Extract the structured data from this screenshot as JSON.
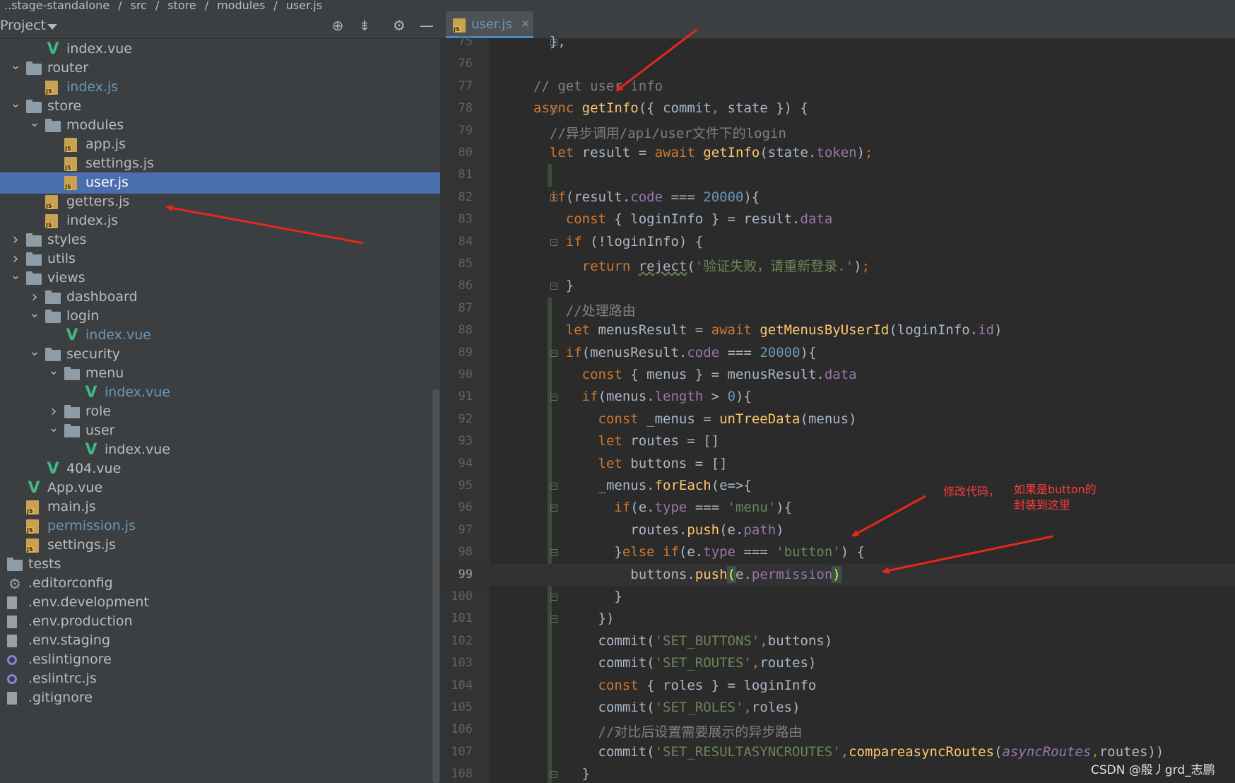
{
  "breadcrumb": {
    "items": [
      "..stage-standalone",
      "src",
      "store",
      "modules",
      "user.js"
    ]
  },
  "project_panel": {
    "title": "Project",
    "header_icons": [
      "locate-icon",
      "collapse-icon",
      "gear-icon",
      "minimize-icon"
    ]
  },
  "tree": [
    {
      "label": "index.vue",
      "type": "vue",
      "depth": 2,
      "arrow": ""
    },
    {
      "label": "router",
      "type": "folder",
      "depth": 1,
      "arrow": "open"
    },
    {
      "label": "index.js",
      "type": "js",
      "depth": 2,
      "arrow": "",
      "color": "blue"
    },
    {
      "label": "store",
      "type": "folder",
      "depth": 1,
      "arrow": "open"
    },
    {
      "label": "modules",
      "type": "folder",
      "depth": 2,
      "arrow": "open"
    },
    {
      "label": "app.js",
      "type": "js",
      "depth": 3,
      "arrow": ""
    },
    {
      "label": "settings.js",
      "type": "js",
      "depth": 3,
      "arrow": ""
    },
    {
      "label": "user.js",
      "type": "js",
      "depth": 3,
      "arrow": "",
      "selected": true
    },
    {
      "label": "getters.js",
      "type": "js",
      "depth": 2,
      "arrow": ""
    },
    {
      "label": "index.js",
      "type": "js",
      "depth": 2,
      "arrow": ""
    },
    {
      "label": "styles",
      "type": "folder",
      "depth": 1,
      "arrow": "closed"
    },
    {
      "label": "utils",
      "type": "folder",
      "depth": 1,
      "arrow": "closed"
    },
    {
      "label": "views",
      "type": "folder",
      "depth": 1,
      "arrow": "open"
    },
    {
      "label": "dashboard",
      "type": "folder",
      "depth": 2,
      "arrow": "closed"
    },
    {
      "label": "login",
      "type": "folder",
      "depth": 2,
      "arrow": "open"
    },
    {
      "label": "index.vue",
      "type": "vue",
      "depth": 3,
      "arrow": "",
      "color": "blue"
    },
    {
      "label": "security",
      "type": "folder",
      "depth": 2,
      "arrow": "open"
    },
    {
      "label": "menu",
      "type": "folder",
      "depth": 3,
      "arrow": "open"
    },
    {
      "label": "index.vue",
      "type": "vue",
      "depth": 4,
      "arrow": "",
      "color": "blue"
    },
    {
      "label": "role",
      "type": "folder",
      "depth": 3,
      "arrow": "closed"
    },
    {
      "label": "user",
      "type": "folder",
      "depth": 3,
      "arrow": "open"
    },
    {
      "label": "index.vue",
      "type": "vue",
      "depth": 4,
      "arrow": ""
    },
    {
      "label": "404.vue",
      "type": "vue",
      "depth": 2,
      "arrow": ""
    },
    {
      "label": "App.vue",
      "type": "vue",
      "depth": 1,
      "arrow": ""
    },
    {
      "label": "main.js",
      "type": "js",
      "depth": 1,
      "arrow": ""
    },
    {
      "label": "permission.js",
      "type": "js",
      "depth": 1,
      "arrow": "",
      "color": "blue"
    },
    {
      "label": "settings.js",
      "type": "js",
      "depth": 1,
      "arrow": ""
    },
    {
      "label": "tests",
      "type": "folder",
      "depth": 0,
      "arrow": ""
    },
    {
      "label": ".editorconfig",
      "type": "gear",
      "depth": 0,
      "arrow": ""
    },
    {
      "label": ".env.development",
      "type": "file",
      "depth": 0,
      "arrow": ""
    },
    {
      "label": ".env.production",
      "type": "file",
      "depth": 0,
      "arrow": ""
    },
    {
      "label": ".env.staging",
      "type": "file",
      "depth": 0,
      "arrow": ""
    },
    {
      "label": ".eslintignore",
      "type": "ring",
      "depth": 0,
      "arrow": ""
    },
    {
      "label": ".eslintrc.js",
      "type": "ring",
      "depth": 0,
      "arrow": ""
    },
    {
      "label": ".gitignore",
      "type": "file",
      "depth": 0,
      "arrow": ""
    }
  ],
  "editor": {
    "tab_label": "user.js",
    "current_line": "99",
    "lines": [
      {
        "n": "75",
        "t": [
          [
            "",
            "  },"
          ]
        ]
      },
      {
        "n": "76",
        "t": []
      },
      {
        "n": "77",
        "t": [
          [
            "cm",
            "// get user info"
          ]
        ]
      },
      {
        "n": "78",
        "t": [
          [
            "kw",
            "async "
          ],
          [
            "fn",
            "getInfo"
          ],
          [
            "",
            "({ commit"
          ],
          [
            "kw",
            ", "
          ],
          [
            "",
            "state }) {"
          ]
        ]
      },
      {
        "n": "79",
        "t": [
          [
            "cm",
            "  //异步调用/api/user文件下的login"
          ]
        ]
      },
      {
        "n": "80",
        "t": [
          [
            "kw",
            "  let "
          ],
          [
            "",
            "result = "
          ],
          [
            "kw",
            "await "
          ],
          [
            "fn",
            "getInfo"
          ],
          [
            "",
            "(state."
          ],
          [
            "prop",
            "token"
          ],
          [
            "",
            ")"
          ],
          [
            "kw",
            ";"
          ]
        ]
      },
      {
        "n": "81",
        "t": []
      },
      {
        "n": "82",
        "t": [
          [
            "kw",
            "  if"
          ],
          [
            "",
            "(result."
          ],
          [
            "prop",
            "code"
          ],
          [
            "",
            " === "
          ],
          [
            "num",
            "20000"
          ],
          [
            "",
            "){"
          ]
        ]
      },
      {
        "n": "83",
        "t": [
          [
            "kw",
            "    const "
          ],
          [
            "",
            "{ loginInfo } = result."
          ],
          [
            "prop",
            "data"
          ]
        ]
      },
      {
        "n": "84",
        "t": [
          [
            "kw",
            "    if "
          ],
          [
            "",
            "(!loginInfo) {"
          ]
        ]
      },
      {
        "n": "85",
        "t": [
          [
            "kw",
            "      return "
          ],
          [
            "und",
            "reject"
          ],
          [
            "",
            "("
          ],
          [
            "str",
            "'验证失败，请重新登录.'"
          ],
          [
            "",
            ")"
          ],
          [
            "kw",
            ";"
          ]
        ]
      },
      {
        "n": "86",
        "t": [
          [
            "",
            "    }"
          ]
        ]
      },
      {
        "n": "87",
        "t": [
          [
            "cm",
            "    //处理路由"
          ]
        ]
      },
      {
        "n": "88",
        "t": [
          [
            "kw",
            "    let "
          ],
          [
            "",
            "menusResult = "
          ],
          [
            "kw",
            "await "
          ],
          [
            "fn",
            "getMenusByUserId"
          ],
          [
            "",
            "(loginInfo."
          ],
          [
            "prop",
            "id"
          ],
          [
            "",
            ")"
          ]
        ]
      },
      {
        "n": "89",
        "t": [
          [
            "kw",
            "    if"
          ],
          [
            "",
            "(menusResult."
          ],
          [
            "prop",
            "code"
          ],
          [
            "",
            " === "
          ],
          [
            "num",
            "20000"
          ],
          [
            "",
            "){"
          ]
        ]
      },
      {
        "n": "90",
        "t": [
          [
            "kw",
            "      const "
          ],
          [
            "",
            "{ menus } = menusResult."
          ],
          [
            "prop",
            "data"
          ]
        ]
      },
      {
        "n": "91",
        "t": [
          [
            "kw",
            "      if"
          ],
          [
            "",
            "(menus."
          ],
          [
            "prop",
            "length"
          ],
          [
            "",
            " > "
          ],
          [
            "num",
            "0"
          ],
          [
            "",
            "){"
          ]
        ]
      },
      {
        "n": "92",
        "t": [
          [
            "kw",
            "        const "
          ],
          [
            "",
            "_menus = "
          ],
          [
            "fn",
            "unTreeData"
          ],
          [
            "",
            "(menus)"
          ]
        ]
      },
      {
        "n": "93",
        "t": [
          [
            "kw",
            "        let "
          ],
          [
            "",
            "routes = []"
          ]
        ]
      },
      {
        "n": "94",
        "t": [
          [
            "kw",
            "        let "
          ],
          [
            "",
            "buttons = []"
          ]
        ]
      },
      {
        "n": "95",
        "t": [
          [
            "",
            "        _menus."
          ],
          [
            "fn",
            "forEach"
          ],
          [
            "",
            "(e=>{"
          ]
        ]
      },
      {
        "n": "96",
        "t": [
          [
            "kw",
            "          if"
          ],
          [
            "",
            "(e."
          ],
          [
            "prop",
            "type"
          ],
          [
            "",
            " === "
          ],
          [
            "str",
            "'menu'"
          ],
          [
            "",
            "){"
          ]
        ]
      },
      {
        "n": "97",
        "t": [
          [
            "",
            "            routes."
          ],
          [
            "fn",
            "push"
          ],
          [
            "",
            "(e."
          ],
          [
            "prop",
            "path"
          ],
          [
            "",
            ")"
          ]
        ]
      },
      {
        "n": "98",
        "t": [
          [
            "",
            "          }"
          ],
          [
            "kw",
            "else if"
          ],
          [
            "",
            "(e."
          ],
          [
            "prop",
            "type"
          ],
          [
            "",
            " === "
          ],
          [
            "str",
            "'button'"
          ],
          [
            "",
            ") {"
          ]
        ]
      },
      {
        "n": "99",
        "t": [
          [
            "",
            "            buttons."
          ],
          [
            "fn",
            "push"
          ],
          [
            "mark",
            "("
          ],
          [
            "",
            "e."
          ],
          [
            "prop",
            "permission"
          ],
          [
            "mark",
            ")"
          ]
        ]
      },
      {
        "n": "100",
        "t": [
          [
            "",
            "          }"
          ]
        ]
      },
      {
        "n": "101",
        "t": [
          [
            "",
            "        })"
          ]
        ]
      },
      {
        "n": "102",
        "t": [
          [
            "",
            "        commit("
          ],
          [
            "str",
            "'SET_BUTTONS'"
          ],
          [
            "kw",
            ","
          ],
          [
            "",
            "buttons)"
          ]
        ]
      },
      {
        "n": "103",
        "t": [
          [
            "",
            "        commit("
          ],
          [
            "str",
            "'SET_ROUTES'"
          ],
          [
            "kw",
            ","
          ],
          [
            "",
            "routes)"
          ]
        ]
      },
      {
        "n": "104",
        "t": [
          [
            "kw",
            "        const "
          ],
          [
            "",
            "{ roles } = loginInfo"
          ]
        ]
      },
      {
        "n": "105",
        "t": [
          [
            "",
            "        commit("
          ],
          [
            "str",
            "'SET_ROLES'"
          ],
          [
            "kw",
            ","
          ],
          [
            "",
            "roles)"
          ]
        ]
      },
      {
        "n": "106",
        "t": [
          [
            "cm",
            "        //对比后设置需要展示的异步路由"
          ]
        ]
      },
      {
        "n": "107",
        "t": [
          [
            "",
            "        commit("
          ],
          [
            "str",
            "'SET_RESULTASYNCROUTES'"
          ],
          [
            "kw",
            ","
          ],
          [
            "fn",
            "compareasyncRoutes"
          ],
          [
            "",
            "("
          ],
          [
            "prop-i",
            "asyncRoutes"
          ],
          [
            "kw",
            ","
          ],
          [
            "",
            "routes))"
          ]
        ]
      },
      {
        "n": "108",
        "t": [
          [
            "",
            "      }"
          ]
        ]
      }
    ]
  },
  "annotations": {
    "note_left": "修改代码，",
    "note_right_1": "如果是button的",
    "note_right_2": "封装到这里",
    "arrow_color": "#e8261c"
  },
  "watermark": "CSDN @殷丿grd_志鹏",
  "colors": {
    "keyword": "#cc7832",
    "function": "#ffc66d",
    "string": "#6a8759",
    "number": "#6897bb",
    "property": "#9876aa",
    "comment": "#808080",
    "selection": "#4b6eaf"
  }
}
